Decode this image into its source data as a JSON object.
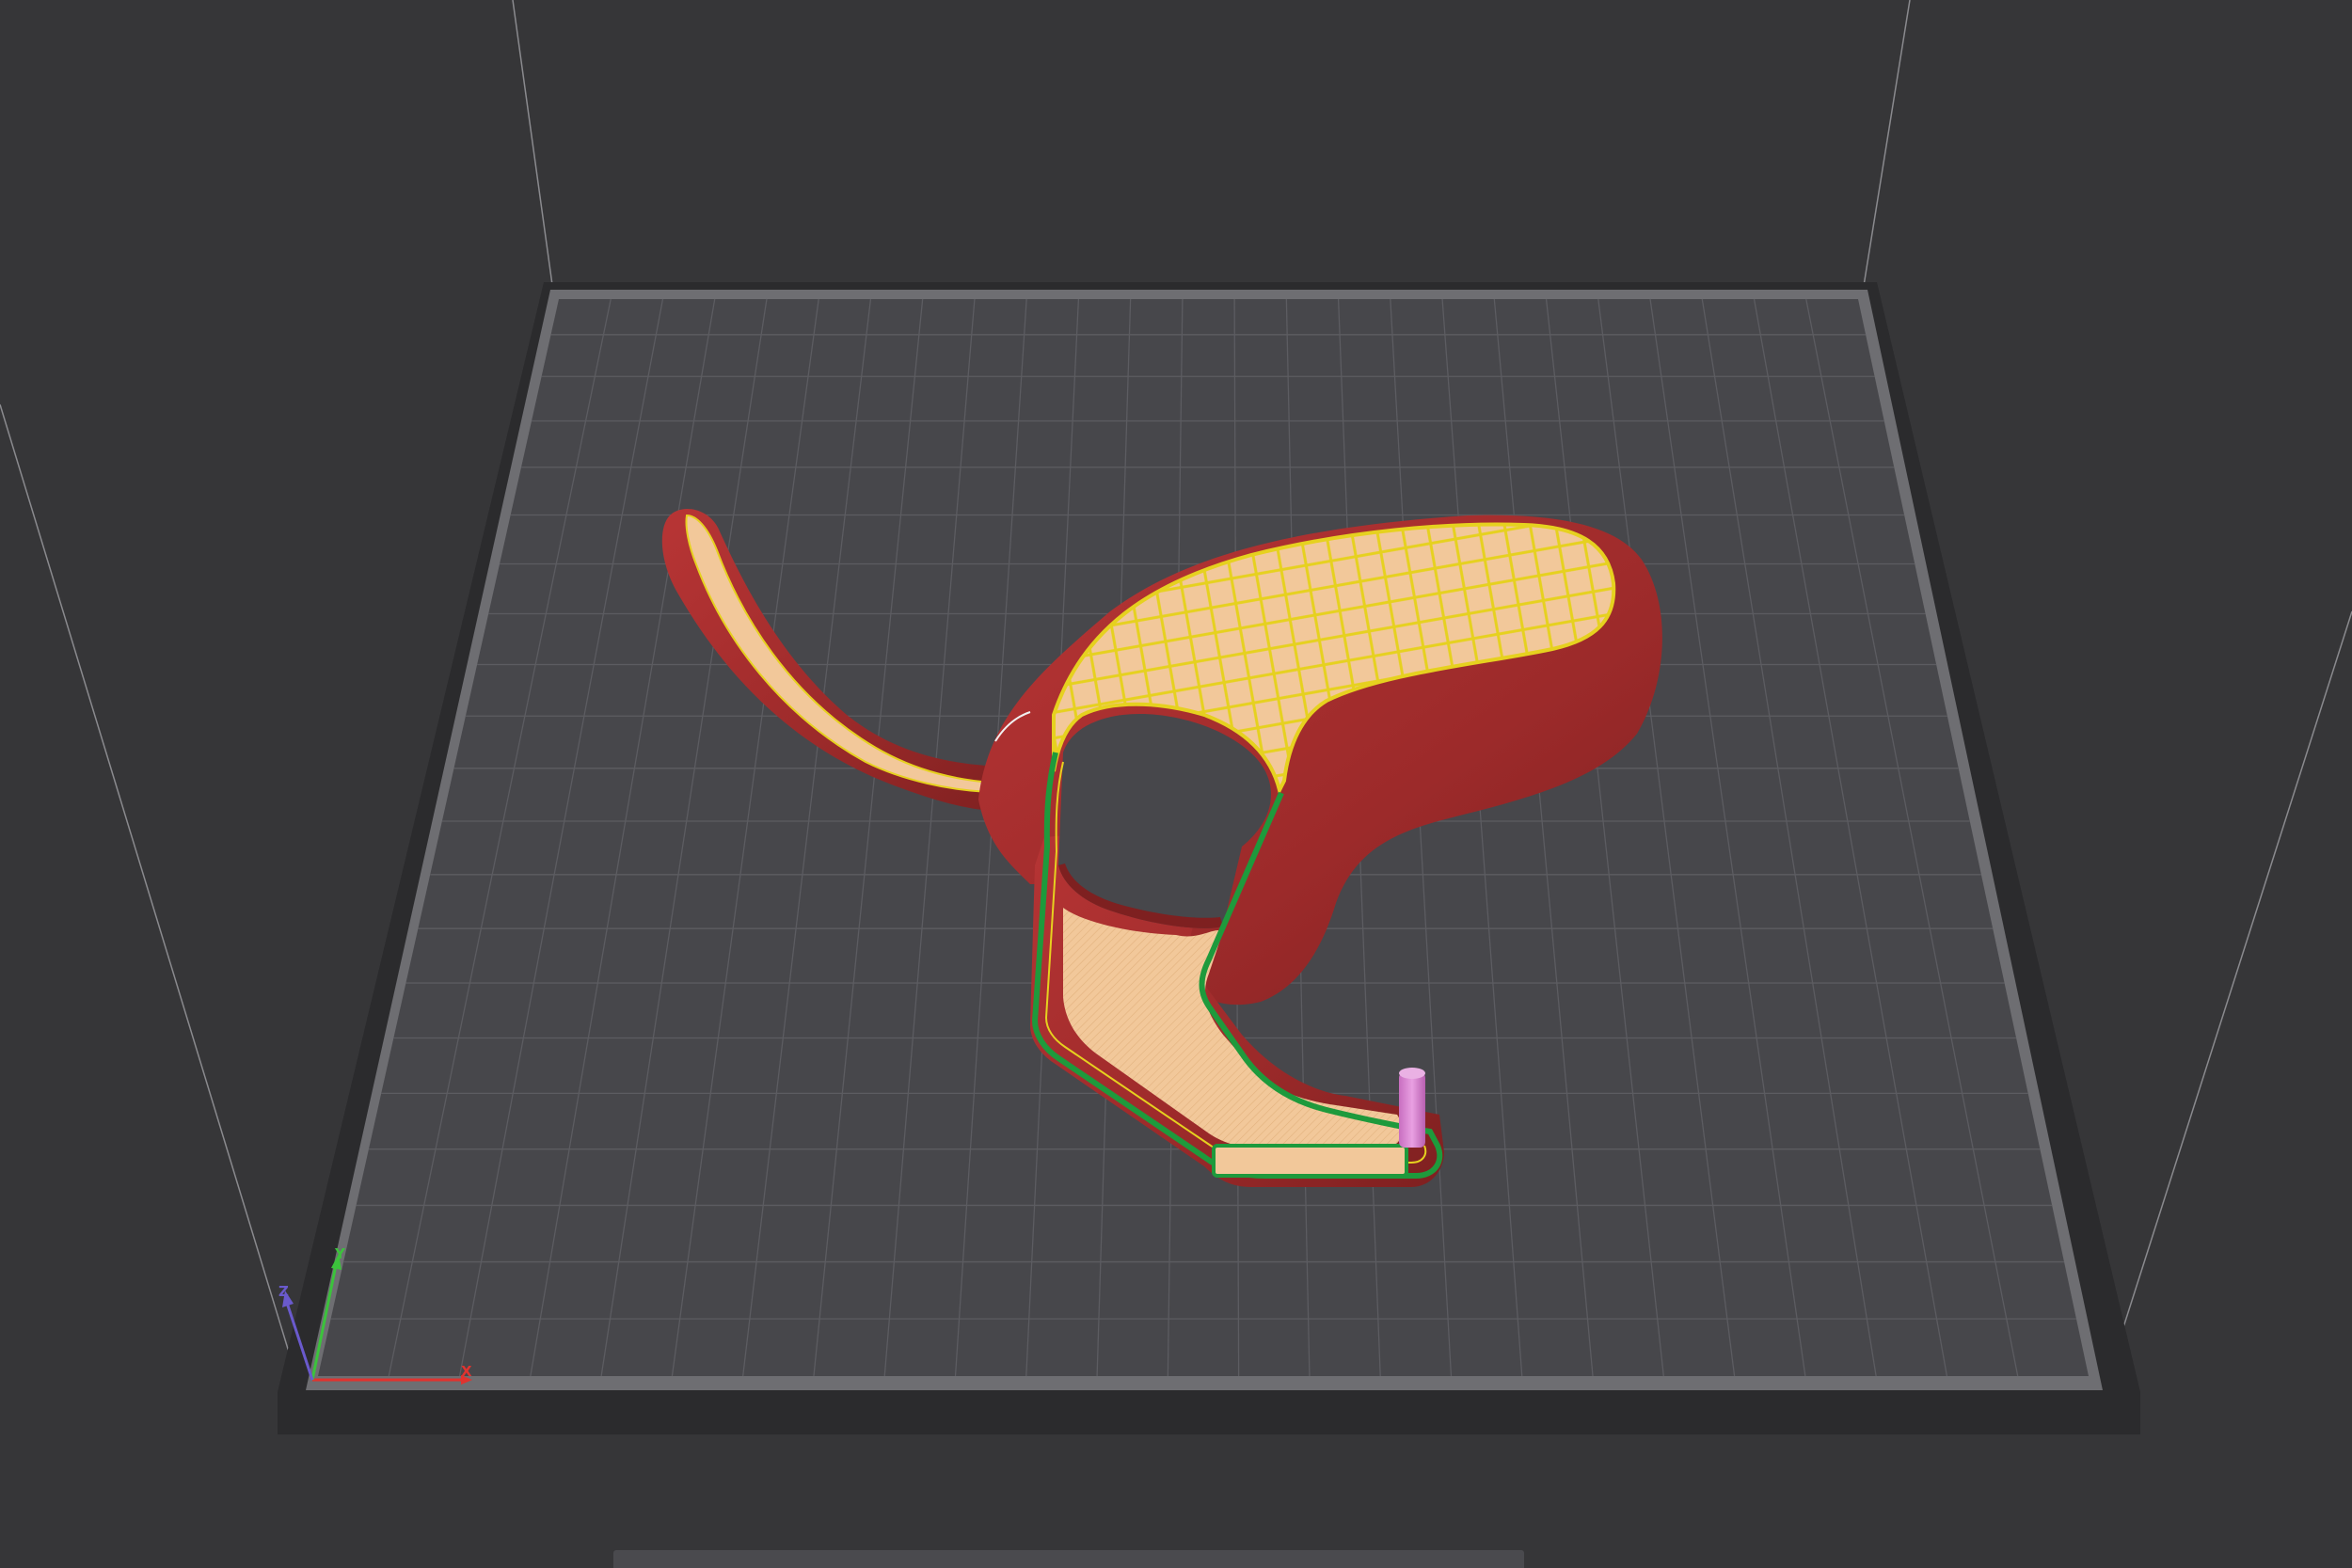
{
  "viewport": {
    "background": "#363638",
    "bed": {
      "frame_color": "#6e6e72",
      "surface_color": "#47474b",
      "grid_color": "#5c5c61",
      "base_color": "#2b2b2d"
    },
    "axes": {
      "x": {
        "label": "X",
        "color": "#e0332f"
      },
      "y": {
        "label": "Y",
        "color": "#3cc23c"
      },
      "z": {
        "label": "Z",
        "color": "#6a5acd"
      }
    },
    "model": {
      "wall_color": "#a52d2d",
      "infill_color": "#f2c89a",
      "sparse_infill_color": "#e6d11f",
      "perimeter_color": "#1e9a3c",
      "tool_color": "#d97fd0"
    }
  },
  "bottom_panel": {
    "color": "#4a4a4e"
  }
}
